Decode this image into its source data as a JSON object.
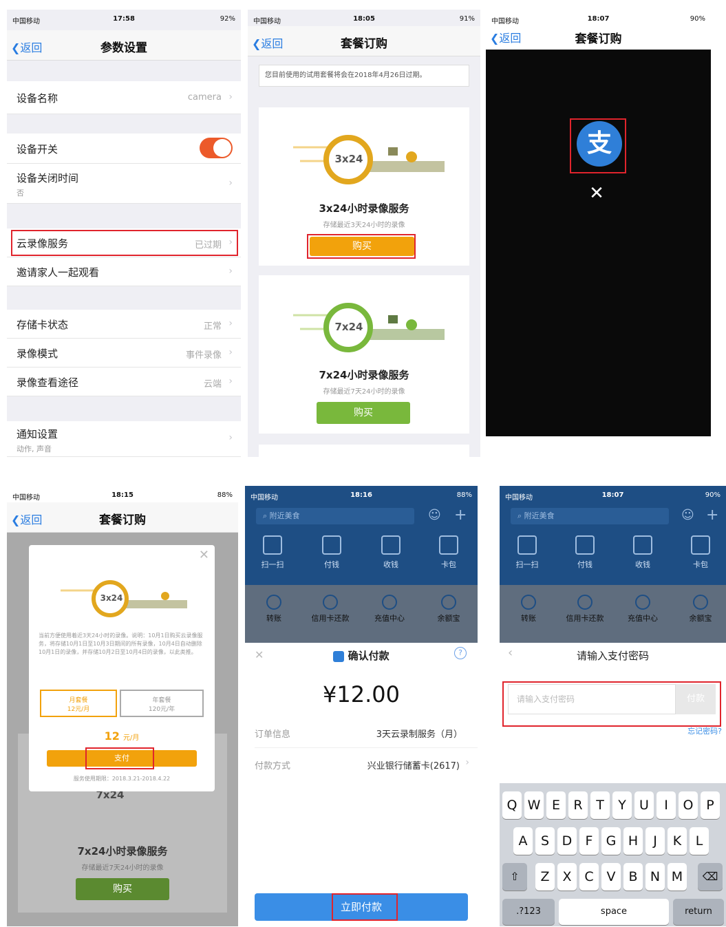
{
  "screen1": {
    "status": {
      "carrier": "中国移动",
      "time": "17:58",
      "battery": "92%"
    },
    "nav": {
      "back": "返回",
      "title": "参数设置"
    },
    "rows": {
      "device_name": {
        "label": "设备名称",
        "value": "camera"
      },
      "device_switch": {
        "label": "设备开关"
      },
      "device_off_time": {
        "label": "设备关闭时间",
        "sub": "否"
      },
      "cloud_service": {
        "label": "云录像服务",
        "value": "已过期"
      },
      "invite_family": {
        "label": "邀请家人一起观看"
      },
      "sd_status": {
        "label": "存储卡状态",
        "value": "正常"
      },
      "record_mode": {
        "label": "录像模式",
        "value": "事件录像"
      },
      "record_view": {
        "label": "录像查看途径",
        "value": "云端"
      },
      "notify": {
        "label": "通知设置",
        "sub": "动作, 声音"
      }
    }
  },
  "screen2": {
    "status": {
      "carrier": "中国移动",
      "time": "18:05",
      "battery": "91%"
    },
    "nav": {
      "back": "返回",
      "title": "套餐订购"
    },
    "notice": "您目前使用的试用套餐将会在2018年4月26日过期。",
    "products": [
      {
        "badge": "3x24",
        "name": "3x24小时录像服务",
        "desc": "存储最近3天24小时的录像",
        "button": "购买",
        "color": "#f2a20c"
      },
      {
        "badge": "7x24",
        "name": "7x24小时录像服务",
        "desc": "存储最近7天24小时的录像",
        "button": "购买",
        "color": "#79b83c"
      }
    ]
  },
  "screen3": {
    "status": {
      "carrier": "中国移动",
      "time": "18:07",
      "battery": "90%"
    },
    "nav": {
      "back": "返回",
      "title": "套餐订购"
    },
    "alipay_glyph": "支",
    "close_glyph": "✕"
  },
  "screen4": {
    "status": {
      "carrier": "中国移动",
      "time": "18:15",
      "battery": "88%"
    },
    "nav": {
      "back": "返回",
      "title": "套餐订购"
    },
    "modal": {
      "badge": "3x24",
      "desc": "当前方便使用着近3天24小时的录像。说明：10月1日购买云录像服务，将存储10月1日至10月3日期间的所有录像，10月4日自动删除10月1日的录像，并存储10月2日至10月4日的录像，以此类推。",
      "option_month": "月套餐\n12元/月",
      "option_year": "年套餐\n120元/年",
      "price": "12",
      "price_unit": "元/月",
      "pay_button": "支付",
      "valid_period": "服务使用期限：2018.3.21-2018.4.22"
    },
    "product_bg": {
      "badge": "7x24",
      "name": "7x24小时录像服务",
      "desc": "存储最近7天24小时的录像",
      "button": "购买"
    }
  },
  "screen5": {
    "status": {
      "carrier": "中国移动",
      "time": "18:16",
      "battery": "88%"
    },
    "search_placeholder": "附近美食",
    "apps": [
      "扫一扫",
      "付钱",
      "收钱",
      "卡包"
    ],
    "shortcuts": [
      "转账",
      "信用卡还款",
      "充值中心",
      "余额宝"
    ],
    "sheet": {
      "title": "确认付款",
      "amount": "¥12.00",
      "order_label": "订单信息",
      "order_value": "3天云录制服务（月）",
      "method_label": "付款方式",
      "method_value": "兴业银行储蓄卡(2617)",
      "confirm_button": "立即付款"
    }
  },
  "screen6": {
    "status": {
      "carrier": "中国移动",
      "time": "18:07",
      "battery": "90%"
    },
    "search_placeholder": "附近美食",
    "apps": [
      "扫一扫",
      "付钱",
      "收钱",
      "卡包"
    ],
    "shortcuts": [
      "转账",
      "信用卡还款",
      "充值中心",
      "余额宝"
    ],
    "sheet": {
      "title": "请输入支付密码",
      "input_placeholder": "请输入支付密码",
      "pay_button": "付款",
      "forgot": "忘记密码?"
    },
    "keyboard": {
      "row1": [
        "Q",
        "W",
        "E",
        "R",
        "T",
        "Y",
        "U",
        "I",
        "O",
        "P"
      ],
      "row2": [
        "A",
        "S",
        "D",
        "F",
        "G",
        "H",
        "J",
        "K",
        "L"
      ],
      "row3": [
        "Z",
        "X",
        "C",
        "V",
        "B",
        "N",
        "M"
      ],
      "num": ".?123",
      "space": "space",
      "return": "return"
    }
  },
  "colors": {
    "accent_blue": "#2a7de1",
    "alert_red": "#e0242c",
    "orange": "#f2a20c",
    "green": "#79b83c",
    "alipay_blue": "#1e4e84"
  }
}
